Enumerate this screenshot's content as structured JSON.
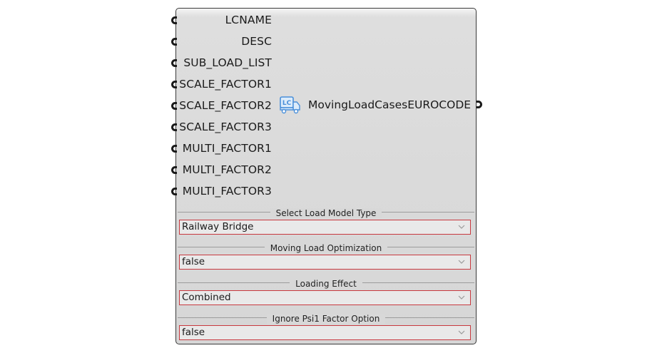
{
  "component": {
    "title": "MovingLoadCasesEUROCODE",
    "icon": "lc-truck-icon",
    "icon_text": "LC",
    "inputs": [
      {
        "label": "LCNAME"
      },
      {
        "label": "DESC"
      },
      {
        "label": "SUB_LOAD_LIST"
      },
      {
        "label": "SCALE_FACTOR1"
      },
      {
        "label": "SCALE_FACTOR2"
      },
      {
        "label": "SCALE_FACTOR3"
      },
      {
        "label": "MULTI_FACTOR1"
      },
      {
        "label": "MULTI_FACTOR2"
      },
      {
        "label": "MULTI_FACTOR3"
      }
    ],
    "options": [
      {
        "heading": "Select Load Model Type",
        "value": "Railway Bridge"
      },
      {
        "heading": "Moving Load Optimization",
        "value": "false"
      },
      {
        "heading": "Loading Effect",
        "value": "Combined"
      },
      {
        "heading": "Ignore Psi1 Factor Option",
        "value": "false"
      }
    ]
  },
  "colors": {
    "dropdown_border": "#c8393f",
    "icon_blue": "#4a8fd9"
  }
}
